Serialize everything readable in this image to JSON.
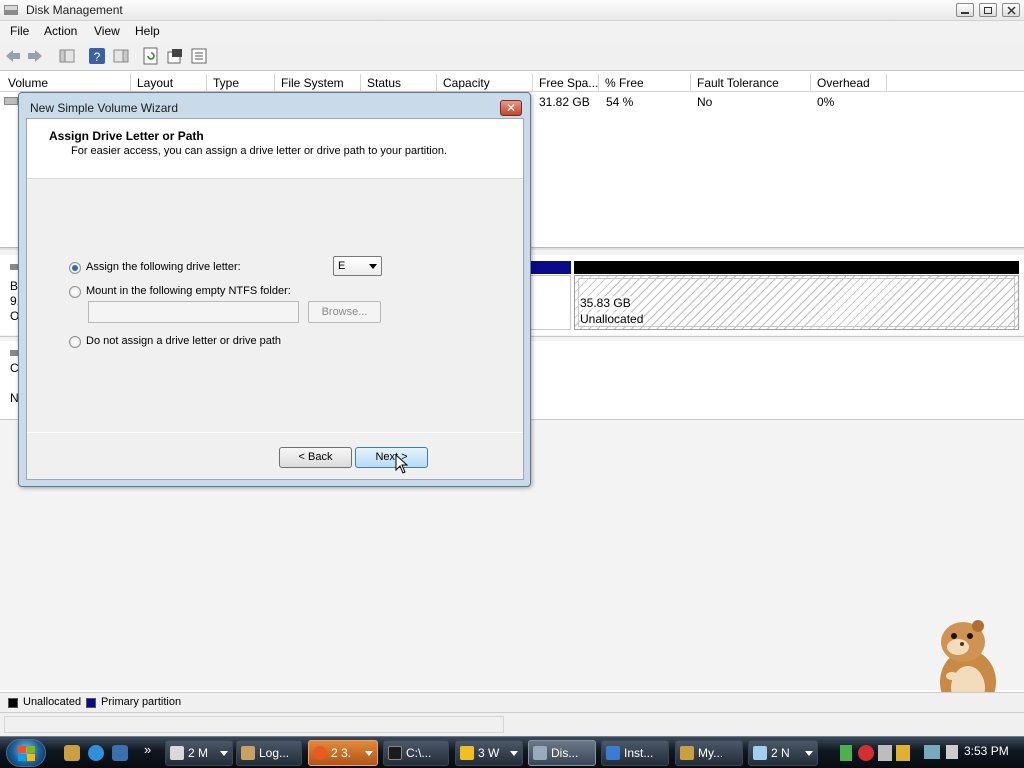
{
  "window": {
    "title": "Disk Management"
  },
  "menu": [
    "File",
    "Action",
    "View",
    "Help"
  ],
  "columns": [
    "Volume",
    "Layout",
    "Type",
    "File System",
    "Status",
    "Capacity",
    "Free Spa...",
    "% Free",
    "Fault Tolerance",
    "Overhead"
  ],
  "volume_row": {
    "free_space": "31.82 GB",
    "pct_free": "54 %",
    "fault_tolerance": "No",
    "overhead": "0%"
  },
  "disk_labels_partial": {
    "disk0_line1": "B",
    "disk0_line2": "9.",
    "disk0_line3": "O",
    "cdrom_line1": "C",
    "cdrom_line2": "N"
  },
  "unallocated_partition": {
    "size": "35.83 GB",
    "label": "Unallocated"
  },
  "legend": {
    "unallocated": "Unallocated",
    "primary": "Primary partition",
    "unallocated_color": "#000000",
    "primary_color": "#0a0a8a"
  },
  "wizard": {
    "title": "New Simple Volume Wizard",
    "heading": "Assign Drive Letter or Path",
    "subheading": "For easier access, you can assign a drive letter or drive path to your partition.",
    "option_assign": "Assign the following drive letter:",
    "option_mount": "Mount in the following empty NTFS folder:",
    "option_none": "Do not assign a drive letter or drive path",
    "selected_option": "assign",
    "drive_letter": "E",
    "browse_label": "Browse...",
    "back_label": "< Back",
    "next_label": "Next >",
    "close_glyph": "✕"
  },
  "taskbar": {
    "buttons": [
      {
        "label": "2 M",
        "icon_color": "#d9d9d9",
        "dropdown": true,
        "active": false
      },
      {
        "label": "Log...",
        "icon_color": "#c8a060",
        "dropdown": false,
        "active": false
      },
      {
        "label": "2 3.",
        "icon_color": "#e85a1e",
        "dropdown": true,
        "active": true
      },
      {
        "label": "C:\\...",
        "icon_color": "#1a1a1a",
        "dropdown": false,
        "active": false
      },
      {
        "label": "3 W",
        "icon_color": "#f0c020",
        "dropdown": true,
        "active": false
      },
      {
        "label": "Dis...",
        "icon_color": "#9ab",
        "dropdown": false,
        "active": true
      },
      {
        "label": "Inst...",
        "icon_color": "#3a7bd5",
        "dropdown": false,
        "active": false
      },
      {
        "label": "My...",
        "icon_color": "#c9a040",
        "dropdown": false,
        "active": false
      },
      {
        "label": "2 N",
        "icon_color": "#9fd0f0",
        "dropdown": true,
        "active": false
      }
    ],
    "overflow_glyph": "»",
    "clock": "3:53 PM"
  }
}
